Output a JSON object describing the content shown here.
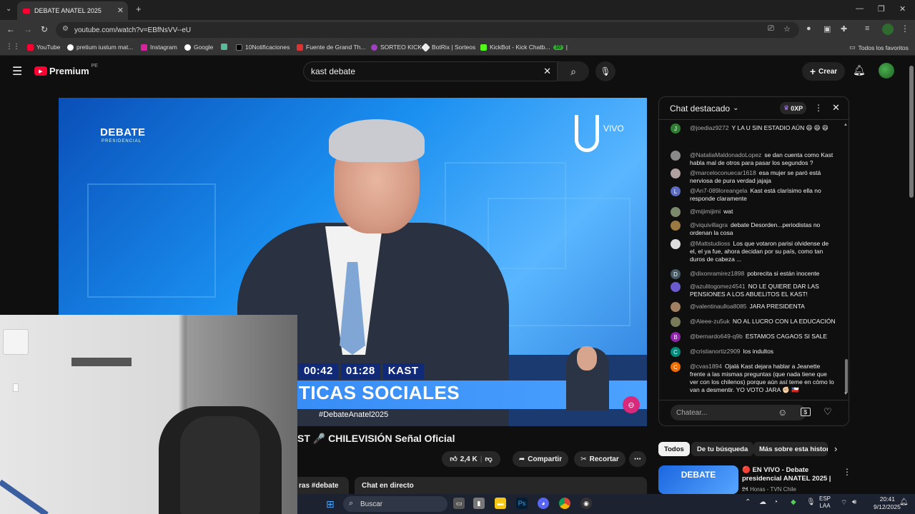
{
  "browser": {
    "tab_title": "DEBATE ANATEL 2025",
    "url": "youtube.com/watch?v=EBfNsVV--eU",
    "bookmarks": [
      "YouTube",
      "pretium iustum mat...",
      "Instagram",
      "Google",
      "10Notificaciones",
      "Fuente de Grand Th...",
      "SORTEO KICK",
      "BotRix | Sorteos",
      "KickBot - Kick Chatb..."
    ],
    "bookmark_badge": "10",
    "all_bookmarks": "Todos los favoritos"
  },
  "youtube": {
    "logo": "Premium",
    "logo_region": "PE",
    "search_value": "kast debate",
    "create_label": "Crear"
  },
  "video": {
    "overlay_brand": "DEBATE",
    "overlay_brand_sub": "PRESIDENCIAL",
    "live_label": "VIVO",
    "timer_1": "00:42",
    "timer_2": "01:28",
    "speaker": "KAST",
    "lower_third": "TICAS SOCIALES",
    "hashtag": "#DebateAnatel2025"
  },
  "below_video": {
    "title": "ST  🎤 CHILEVISIÓN Señal Oficial",
    "likes": "2,4 K",
    "share_label": "Compartir",
    "clip_label": "Recortar",
    "desc_tag": "ras  #debate",
    "live_chat_label": "Chat en directo"
  },
  "chat": {
    "header": "Chat destacado",
    "points": "0XP",
    "input_placeholder": "Chatear...",
    "messages": [
      {
        "avatar": "J",
        "color": "#2e7d32",
        "user": "@joediaz9272",
        "text": "Y LA U SIN ESTADIO AÚN 😆 😆 😆"
      },
      {
        "avatar": "",
        "color": "#8a8a8a",
        "user": "@NataliaMaldonadoLopez",
        "text": "se dan cuenta como Kast habla mal de otros para pasar los segundos ?"
      },
      {
        "avatar": "",
        "color": "#b0a0a0",
        "user": "@marceloconuecar1618",
        "text": "esa mujer se paró está nerviosa de pura verdad jajaja"
      },
      {
        "avatar": "L",
        "color": "#5c6bc0",
        "user": "@An7-089loreangela",
        "text": "Kast está clarísimo ella no responde claramente"
      },
      {
        "avatar": "",
        "color": "#7a8a6a",
        "user": "@mijimijimi",
        "text": "wat"
      },
      {
        "avatar": "",
        "color": "#9a7a40",
        "user": "@viquivillagra",
        "text": "debate Desorden...periodistas no ordenan la cosa"
      },
      {
        "avatar": "",
        "color": "#dddddd",
        "user": "@Mattstudioss",
        "text": "Los que votaron parisi olvidense de el, el ya fue, ahora decidan por su país, como tan duros de cabeza ..."
      },
      {
        "avatar": "D",
        "color": "#455a64",
        "user": "@dixonramirez1898",
        "text": "pobrecita si están inocente"
      },
      {
        "avatar": "",
        "color": "#6a5acd",
        "user": "@azulitogomez4541",
        "text": "NO LE QUIERE DAR LAS PENSIONES A LOS ABUELITOS EL KAST!"
      },
      {
        "avatar": "",
        "color": "#a08060",
        "user": "@valentinaulloa8085",
        "text": "JARA PRESIDENTA"
      },
      {
        "avatar": "",
        "color": "#7a7a5a",
        "user": "@Aleee-zu5uk",
        "text": "NO AL LUCRO CON LA EDUCACIÓN"
      },
      {
        "avatar": "B",
        "color": "#8e24aa",
        "user": "@bernardo649-q9b",
        "text": "ESTAMOS CAGAOS SI SALE"
      },
      {
        "avatar": "C",
        "color": "#00897b",
        "user": "@cristianortiz2909",
        "text": "los indultos"
      },
      {
        "avatar": "C",
        "color": "#ef6c00",
        "user": "@cvas1894",
        "text": "Ojalá Kast dejara hablar a Jeanette frente a las mismas preguntas (que nada tiene que ver con los chilenos) porque aún así teme en cómo lo van a desmentir. YO VOTO JARA ✊🏻 🇨🇱"
      }
    ]
  },
  "chips": [
    "Todos",
    "De tu búsqueda",
    "Más sobre esta histor"
  ],
  "recommendation": {
    "thumb_text": "DEBATE",
    "title": "🔴 EN VIVO - Debate presidencial ANATEL 2025 | ...",
    "channel": "24 Horas - TVN Chile"
  },
  "taskbar": {
    "search_label": "Buscar",
    "lang_1": "ESP",
    "lang_2": "LAA",
    "time": "20:41",
    "date": "9/12/2025"
  },
  "colors": {
    "youtube_red": "#ff0033",
    "chrome_dark": "#353535",
    "video_blue": "#1a8ff0"
  }
}
